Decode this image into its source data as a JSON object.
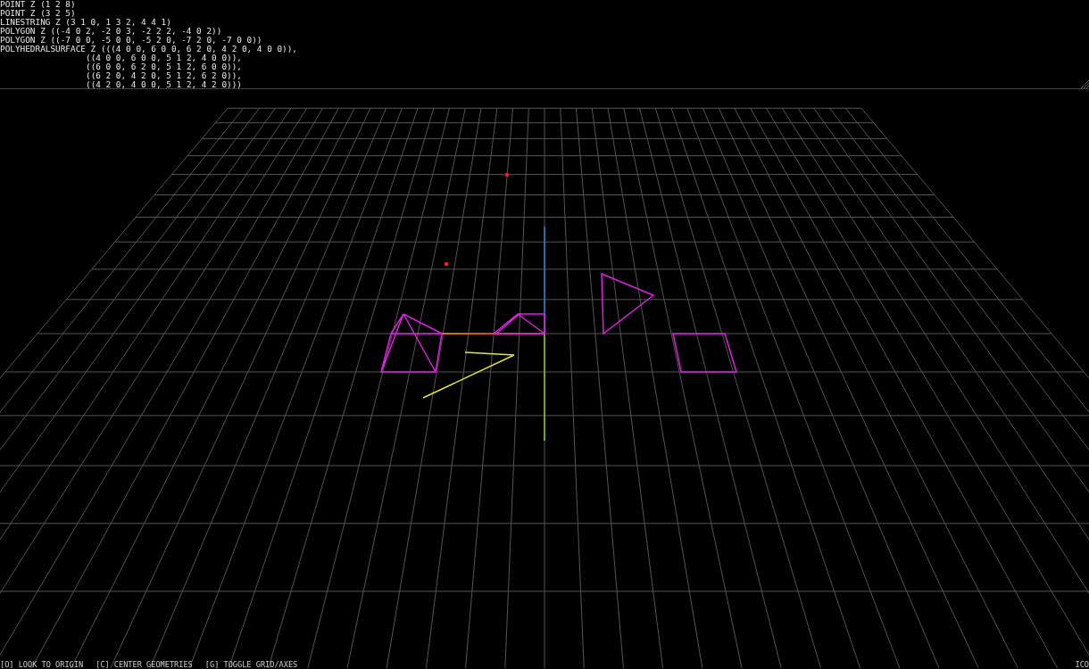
{
  "wkt_panel": {
    "lines": [
      {
        "text": "POINT Z (1 2 8)",
        "kind": "start"
      },
      {
        "text": "POINT Z (3 2 5)",
        "kind": "start"
      },
      {
        "text": "LINESTRING Z (3 1 0, 1 3 2, 4 4 1)",
        "kind": "start"
      },
      {
        "text": "POLYGON Z ((-4 0 2, -2 0 3, -2 2 2, -4 0 2))",
        "kind": "start"
      },
      {
        "text": "POLYGON Z ((-7 0 0, -5 0 0, -5 2 0, -7 2 0, -7 0 0))",
        "kind": "start"
      },
      {
        "text": "POLYHEDRALSURFACE Z (((4 0 0, 6 0 0, 6 2 0, 4 2 0, 4 0 0)),",
        "kind": "start"
      },
      {
        "text": "((4 0 0, 6 0 0, 5 1 2, 4 0 0)),",
        "kind": "continuation"
      },
      {
        "text": "((6 0 0, 6 2 0, 5 1 2, 6 0 0)),",
        "kind": "continuation"
      },
      {
        "text": "((6 2 0, 4 2 0, 5 1 2, 6 2 0)),",
        "kind": "continuation"
      },
      {
        "text": "((4 2 0, 4 0 0, 5 1 2, 4 2 0)))",
        "kind": "continuation"
      }
    ]
  },
  "status_bar": {
    "hints": [
      "[O] LOOK TO ORIGIN",
      "[C] CENTER GEOMETRIES",
      "[G] TOGGLE GRID/AXES"
    ],
    "right_text": "ICO"
  }
}
